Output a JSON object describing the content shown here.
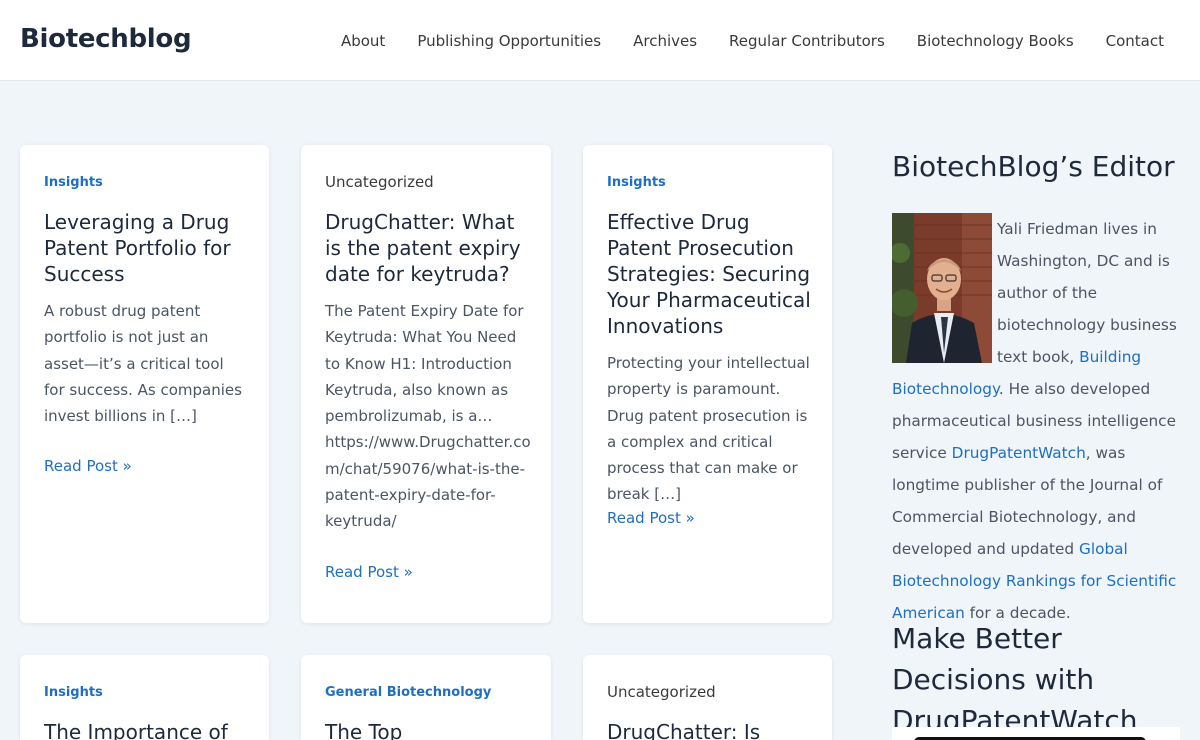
{
  "site": {
    "logo": "Biotechblog"
  },
  "nav": {
    "items": [
      {
        "label": "About"
      },
      {
        "label": "Publishing Opportunities"
      },
      {
        "label": "Archives"
      },
      {
        "label": "Regular Contributors"
      },
      {
        "label": "Biotechnology Books"
      },
      {
        "label": "Contact"
      }
    ]
  },
  "posts": [
    {
      "category": "Insights",
      "title": "Leveraging a Drug Patent Portfolio for Success",
      "excerpt": "A robust drug patent portfolio is not just an asset—it’s a critical tool for success. As companies invest billions in […]",
      "read_more": "Read Post »"
    },
    {
      "category": "Uncategorized",
      "title": "DrugChatter: What is the patent expiry date for keytruda?",
      "excerpt": "The Patent Expiry Date for Keytruda: What You Need to Know H1: Introduction Keytruda, also known as pembrolizumab, is a… https://www.Drugchatter.com/chat/59076/what-is-the-patent-expiry-date-for-keytruda/",
      "read_more": "Read Post »"
    },
    {
      "category": "Insights",
      "title": "Effective Drug Patent Prosecution Strategies: Securing Your Pharmaceutical Innovations",
      "excerpt": "Protecting your intellectual property is paramount. Drug patent prosecution is a complex and critical process that can make or break […]",
      "read_more": "Read Post »"
    },
    {
      "category": "Insights",
      "title": "The Importance of"
    },
    {
      "category": "General Biotechnology",
      "title": "The Top"
    },
    {
      "category": "Uncategorized",
      "title": "DrugChatter: Is"
    }
  ],
  "sidebar": {
    "editor_heading": "BiotechBlog’s Editor",
    "bio": {
      "t1": "Yali Friedman lives in Washington, DC and is author of the biotechnology business text book, ",
      "link1": "Building Biotechnology",
      "t2": ". He also developed pharmaceutical business intelligence service ",
      "link2": "DrugPatentWatch",
      "t3": ", was longtime publisher of the Journal of Commercial Biotechnology, and developed and updated ",
      "link3": "Global Biotechnology Rankings for Scientific American",
      "t4": " for a decade."
    },
    "promo_heading": "Make Better Decisions with DrugPatentWatch"
  },
  "colors": {
    "accent": "#1e6fc2",
    "background": "#f0f5fa",
    "heading": "#1e293b"
  }
}
